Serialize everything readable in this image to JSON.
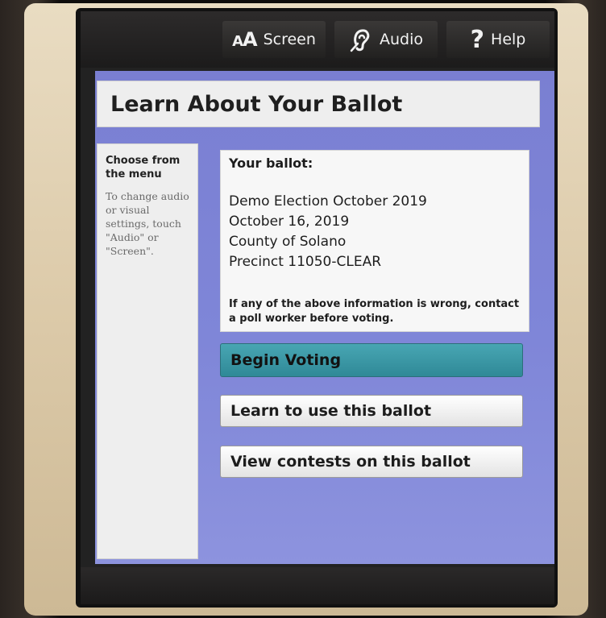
{
  "toolbar": {
    "screen_label": "Screen",
    "screen_icon_small": "A",
    "screen_icon_big": "A",
    "audio_label": "Audio",
    "help_label": "Help",
    "help_icon": "?"
  },
  "page": {
    "title": "Learn About Your Ballot"
  },
  "sidebar": {
    "heading": "Choose from the menu",
    "text": "To change audio or visual settings, touch \"Audio\" or \"Screen\"."
  },
  "ballot_info": {
    "heading": "Your ballot:",
    "lines": [
      "Demo Election October 2019",
      "October 16, 2019",
      "County of Solano",
      "Precinct 11050-CLEAR"
    ],
    "warning": "If any of the above information is wrong, contact a poll worker before voting."
  },
  "actions": {
    "begin_voting": "Begin Voting",
    "learn_ballot": "Learn to use this ballot",
    "view_contests": "View contests on this ballot"
  },
  "colors": {
    "content_bg": "#7f86d8",
    "primary_button": "#3a97a4",
    "panel_bg": "#eeeeee"
  },
  "icons": {
    "screen": "text-size-icon",
    "audio": "ear-icon",
    "help": "question-mark-icon"
  }
}
